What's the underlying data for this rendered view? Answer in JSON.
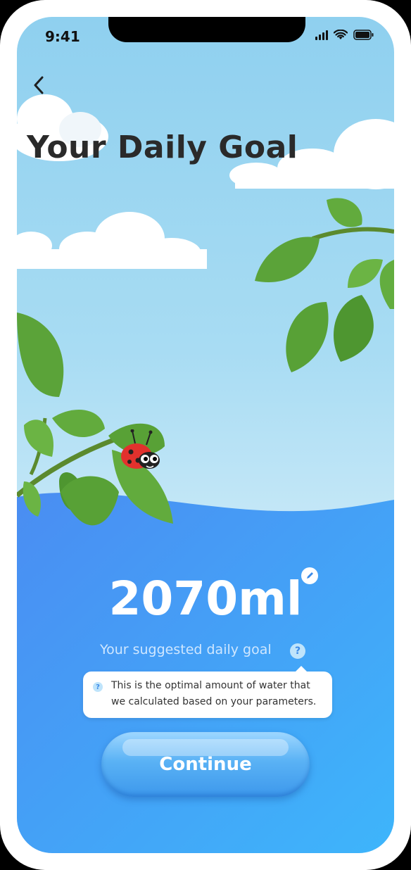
{
  "status": {
    "time": "9:41"
  },
  "header": {
    "title": "Your Daily Goal"
  },
  "goal": {
    "value": "2070ml",
    "subtitle": "Your suggested daily goal"
  },
  "tooltip": {
    "text": "This is the optimal amount of water that we calculated based on your parameters."
  },
  "actions": {
    "continue_label": "Continue"
  },
  "colors": {
    "sky": "#8fd0ef",
    "water_top": "#4a95f2",
    "water_bottom": "#3eb2fb",
    "title": "#2a2a2a"
  },
  "icons": [
    "back-arrow-icon",
    "signal-icon",
    "wifi-icon",
    "battery-icon",
    "edit-icon",
    "question-icon",
    "ladybug-icon",
    "leaf-icon",
    "cloud-icon"
  ]
}
